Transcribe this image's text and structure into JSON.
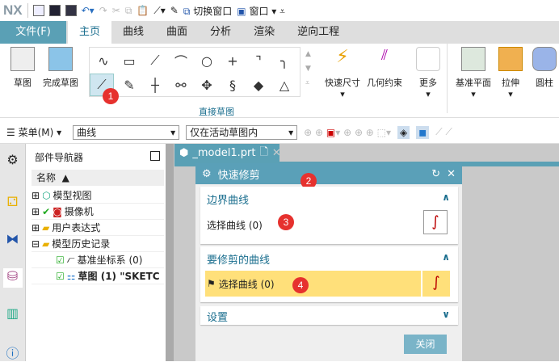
{
  "quick_access": {
    "logo": "NX",
    "switch_window": "切换窗口",
    "window": "窗口"
  },
  "tabs": [
    "文件(F)",
    "主页",
    "曲线",
    "曲面",
    "分析",
    "渲染",
    "逆向工程"
  ],
  "ribbon": {
    "sketch": "草图",
    "finish_sketch": "完成草图",
    "group_label": "直接草图",
    "rapid_dimension": "快速尺寸",
    "geometric_constraints": "几何约束",
    "more": "更多",
    "datum_plane": "基准平面",
    "extrude": "拉伸",
    "cylinder": "圆柱"
  },
  "toolbar2": {
    "menu": "菜单(M)",
    "filter": "曲线",
    "scope": "仅在活动草图内"
  },
  "navigator": {
    "title": "部件导航器",
    "column": "名称",
    "items": [
      "模型视图",
      "摄像机",
      "用户表达式",
      "模型历史记录",
      "基准坐标系 (0)",
      "草图 (1) \"SKETC"
    ]
  },
  "file_tab": "_model1.prt",
  "dialog": {
    "title": "快速修剪",
    "sections": [
      {
        "title": "边界曲线",
        "select": "选择曲线 (0)"
      },
      {
        "title": "要修剪的曲线",
        "select": "选择曲线 (0)"
      },
      {
        "title": "设置"
      }
    ],
    "close": "关闭"
  },
  "badges": [
    "1",
    "2",
    "3",
    "4"
  ]
}
